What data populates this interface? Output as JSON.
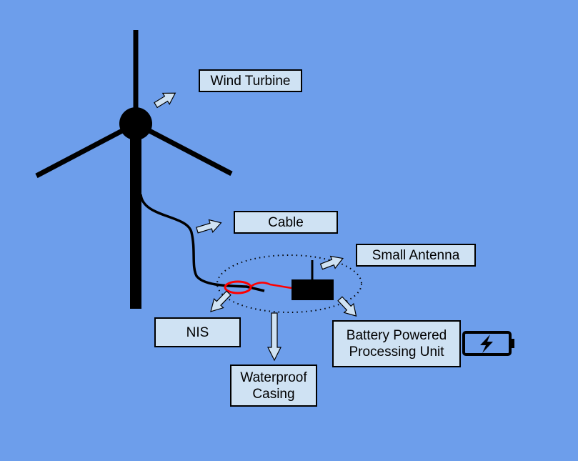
{
  "labels": {
    "wind_turbine": "Wind Turbine",
    "cable": "Cable",
    "small_antenna": "Small Antenna",
    "nis": "NIS",
    "battery_line1": "Battery Powered",
    "battery_line2": "Processing Unit",
    "casing_line1": "Waterproof",
    "casing_line2": "Casing"
  },
  "icons": {
    "battery": "battery-charging-icon"
  },
  "colors": {
    "background": "#6d9eeb",
    "label_fill": "#cfe2f3",
    "outline": "#000000",
    "sensor_loop": "#ff0000"
  }
}
